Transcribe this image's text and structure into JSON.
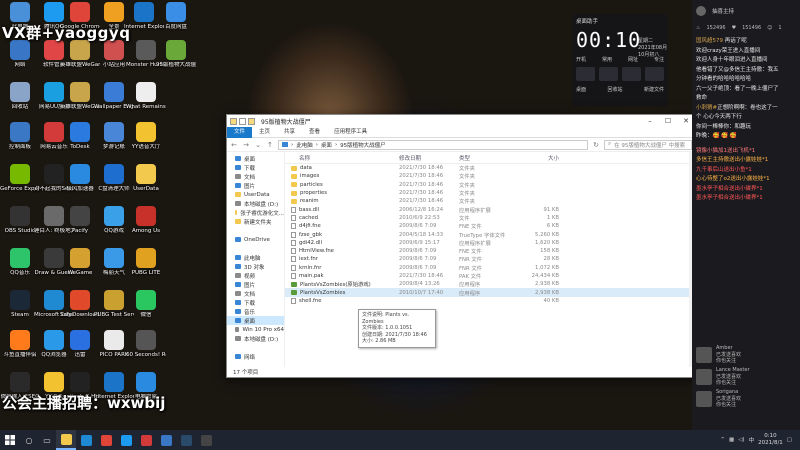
{
  "overlay": {
    "top_text": "VX群+yaoggyq",
    "bottom_text": "公会主播招聘：wxwbij"
  },
  "desktop_icons": [
    {
      "label": "此电脑",
      "color": "#4a90d9",
      "col": 0,
      "row": 0
    },
    {
      "label": "腾讯QQ",
      "color": "#1d9bf0",
      "col": 1,
      "row": 0
    },
    {
      "label": "Google Chrome",
      "color": "#e0453a",
      "col": 2,
      "row": 0
    },
    {
      "label": "全景",
      "color": "#f0a020",
      "col": 3,
      "row": 0
    },
    {
      "label": "Internet Explorer",
      "color": "#1c74c8",
      "col": 3,
      "row": 0.0
    },
    {
      "label": "百度网盘",
      "color": "#3a8ee6",
      "col": 4,
      "row": 0
    },
    {
      "label": "网络",
      "color": "#3a76c6",
      "col": 0,
      "row": 1
    },
    {
      "label": "软件管家",
      "color": "#e04646",
      "col": 1,
      "row": 1
    },
    {
      "label": "英雄联盟WeGame版",
      "color": "#c8a44a",
      "col": 2,
      "row": 1
    },
    {
      "label": "小站应用",
      "color": "#d05050",
      "col": 3,
      "row": 1
    },
    {
      "label": "Monster Hunter ...",
      "color": "#5a5a5a",
      "col": 4,
      "row": 1
    },
    {
      "label": "95版植物大战僵尸",
      "color": "#6aa83a",
      "col": 5,
      "row": 1
    },
    {
      "label": "回收站",
      "color": "#8aa4c8",
      "col": 0,
      "row": 2
    },
    {
      "label": "网易UU加速",
      "color": "#1aa0e0",
      "col": 1,
      "row": 2
    },
    {
      "label": "英雄联盟WeGame版",
      "color": "#c8a44a",
      "col": 2,
      "row": 2
    },
    {
      "label": "Wallpaper Engine:...",
      "color": "#3a7cd6",
      "col": 3,
      "row": 2
    },
    {
      "label": "What Remains ...",
      "color": "#eeeeee",
      "col": 4,
      "row": 2
    },
    {
      "label": "控制面板",
      "color": "#3a78c6",
      "col": 0,
      "row": 3
    },
    {
      "label": "网易云音乐",
      "color": "#d33a3a",
      "col": 1,
      "row": 3
    },
    {
      "label": "ToDesk",
      "color": "#2a7ae0",
      "col": 2,
      "row": 3
    },
    {
      "label": "梦游记账",
      "color": "#4a86d8",
      "col": 3,
      "row": 3
    },
    {
      "label": "YY语音大厅",
      "color": "#f2c230",
      "col": 4,
      "row": 3
    },
    {
      "label": "GeForce Experience",
      "color": "#76b900",
      "col": 0,
      "row": 4
    },
    {
      "label": "对不起我的Soul Dossier",
      "color": "#222222",
      "col": 1,
      "row": 4
    },
    {
      "label": "极风加速器",
      "color": "#2a8ae0",
      "col": 2,
      "row": 4
    },
    {
      "label": "C盘清理大师",
      "color": "#1e6ed0",
      "col": 3,
      "row": 4
    },
    {
      "label": "UserData",
      "color": "#f3c94d",
      "col": 4,
      "row": 4
    },
    {
      "label": "OBS Studio",
      "color": "#333333",
      "col": 0,
      "row": 5
    },
    {
      "label": "锤目人: 终极地大篇",
      "color": "#6a6a6a",
      "col": 1,
      "row": 5
    },
    {
      "label": "Pacify",
      "color": "#444444",
      "col": 2,
      "row": 5
    },
    {
      "label": "QQ游戏",
      "color": "#3aa0e8",
      "col": 3,
      "row": 5
    },
    {
      "label": "Among Us",
      "color": "#c8302a",
      "col": 4,
      "row": 5
    },
    {
      "label": "QQ音乐",
      "color": "#2ec46a",
      "col": 0,
      "row": 6
    },
    {
      "label": "Draw & Guess",
      "color": "#3a3a3a",
      "col": 1,
      "row": 6
    },
    {
      "label": "WeGame",
      "color": "#d4a030",
      "col": 2,
      "row": 6
    },
    {
      "label": "梅丽天气",
      "color": "#3a9ae8",
      "col": 3,
      "row": 6
    },
    {
      "label": "PUBG LITE",
      "color": "#e0a020",
      "col": 4,
      "row": 6
    },
    {
      "label": "Steam",
      "color": "#1b2838",
      "col": 0,
      "row": 7
    },
    {
      "label": "Microsoft Edge",
      "color": "#1f8ad2",
      "col": 1,
      "row": 7
    },
    {
      "label": "SafeDownloader_sogo...",
      "color": "#e04a2a",
      "col": 2,
      "row": 7
    },
    {
      "label": "PUBG Test Server",
      "color": "#caa030",
      "col": 3,
      "row": 7
    },
    {
      "label": "微信",
      "color": "#2ac760",
      "col": 4,
      "row": 7
    },
    {
      "label": "斗鱼直播伴侣",
      "color": "#ff7a1a",
      "col": 0,
      "row": 8
    },
    {
      "label": "QQ浏览器",
      "color": "#2a9ae8",
      "col": 1,
      "row": 8
    },
    {
      "label": "迅雷",
      "color": "#2a70e0",
      "col": 2,
      "row": 8
    },
    {
      "label": "PICO PARK",
      "color": "#eaeaea",
      "col": 3,
      "row": 8
    },
    {
      "label": "60 Seconds! Reatomized",
      "color": "#555555",
      "col": 4,
      "row": 8
    },
    {
      "label": "微信输入法SEO",
      "color": "#2a2a2a",
      "col": 0,
      "row": 9
    },
    {
      "label": "YY语音",
      "color": "#f2c230",
      "col": 1,
      "row": 9
    },
    {
      "label": "Logitech G HUB 9.02",
      "color": "#222222",
      "col": 2,
      "row": 9
    },
    {
      "label": "Internet Explorer",
      "color": "#1c74c8",
      "col": 3,
      "row": 9
    },
    {
      "label": "电脑管家",
      "color": "#2a8ae0",
      "col": 4,
      "row": 9
    }
  ],
  "clock_widget": {
    "title": "桌面助手",
    "time": "00:10",
    "date_line1": "星期二",
    "date_line2": "2021年08月",
    "date_line3": "10月初八",
    "links": [
      "开机",
      "常用",
      "网址",
      "专注",
      "文件"
    ],
    "actions": [
      "桌面",
      "回收站",
      "新建文件"
    ]
  },
  "explorer": {
    "title": "95版植物大战僵尸",
    "ribbon_tabs": [
      "文件",
      "主页",
      "共享",
      "查看",
      "应用程序工具"
    ],
    "active_tab_index": 0,
    "address_parts": [
      "此电脑",
      "桌面",
      "95版植物大战僵尸"
    ],
    "search_placeholder": "在 95版植物大战僵尸 中搜索",
    "nav_items": [
      {
        "label": "桌面",
        "color": "#3a86d6",
        "selected": false
      },
      {
        "label": "下载",
        "color": "#3a86d6",
        "selected": false
      },
      {
        "label": "文档",
        "color": "#8a8a8a",
        "selected": false
      },
      {
        "label": "图片",
        "color": "#3a86d6",
        "selected": false
      },
      {
        "label": "UserData",
        "color": "#f3c94d",
        "selected": false
      },
      {
        "label": "本地磁盘 (D:)",
        "color": "#888888",
        "selected": false
      },
      {
        "label": "张子睿优游化文...",
        "color": "#f3c94d",
        "selected": false
      },
      {
        "label": "新建文件夹",
        "color": "#f3c94d",
        "selected": false
      },
      {
        "label": "",
        "color": "transparent",
        "selected": false
      },
      {
        "label": "OneDrive",
        "color": "#3a86d6",
        "selected": false
      },
      {
        "label": "",
        "color": "transparent",
        "selected": false
      },
      {
        "label": "此电脑",
        "color": "#3a86d6",
        "selected": false
      },
      {
        "label": "3D 对象",
        "color": "#3a86d6",
        "selected": false
      },
      {
        "label": "视频",
        "color": "#8a8a8a",
        "selected": false
      },
      {
        "label": "图片",
        "color": "#3a86d6",
        "selected": false
      },
      {
        "label": "文档",
        "color": "#8a8a8a",
        "selected": false
      },
      {
        "label": "下载",
        "color": "#3a86d6",
        "selected": false
      },
      {
        "label": "音乐",
        "color": "#3a86d6",
        "selected": false
      },
      {
        "label": "桌面",
        "color": "#3a86d6",
        "selected": true
      },
      {
        "label": "Win 10 Pro x64",
        "color": "#888888",
        "selected": false
      },
      {
        "label": "本地磁盘 (D:)",
        "color": "#888888",
        "selected": false
      },
      {
        "label": "",
        "color": "transparent",
        "selected": false
      },
      {
        "label": "网络",
        "color": "#3a86d6",
        "selected": false
      }
    ],
    "columns": [
      "名称",
      "修改日期",
      "类型",
      "大小"
    ],
    "files": [
      {
        "name": "data",
        "date": "2021/7/30 18:46",
        "type": "文件夹",
        "size": "",
        "icon": "folder"
      },
      {
        "name": "images",
        "date": "2021/7/30 18:46",
        "type": "文件夹",
        "size": "",
        "icon": "folder"
      },
      {
        "name": "particles",
        "date": "2021/7/30 18:46",
        "type": "文件夹",
        "size": "",
        "icon": "folder"
      },
      {
        "name": "properties",
        "date": "2021/7/30 18:46",
        "type": "文件夹",
        "size": "",
        "icon": "folder"
      },
      {
        "name": "reanim",
        "date": "2021/7/30 18:46",
        "type": "文件夹",
        "size": "",
        "icon": "folder"
      },
      {
        "name": "bass.dll",
        "date": "2006/12/8 16:24",
        "type": "应用程序扩展",
        "size": "91 KB",
        "icon": "file"
      },
      {
        "name": "cached",
        "date": "2010/6/9 22:53",
        "type": "文件",
        "size": "1 KB",
        "icon": "file"
      },
      {
        "name": "d4jfi.fne",
        "date": "2009/8/6 7:09",
        "type": "FNE 文件",
        "size": "6 KB",
        "icon": "file"
      },
      {
        "name": "fzse_gbk",
        "date": "2004/5/18 14:33",
        "type": "TrueType 字体文件",
        "size": "5,260 KB",
        "icon": "file"
      },
      {
        "name": "gdi42.dll",
        "date": "2009/6/9 15:17",
        "type": "应用程序扩展",
        "size": "1,620 KB",
        "icon": "file"
      },
      {
        "name": "HtmlView.fne",
        "date": "2009/8/6 7:09",
        "type": "FNE 文件",
        "size": "158 KB",
        "icon": "file"
      },
      {
        "name": "iext.fnr",
        "date": "2009/8/6 7:09",
        "type": "FNR 文件",
        "size": "28 KB",
        "icon": "file"
      },
      {
        "name": "krnln.fnr",
        "date": "2009/8/6 7:09",
        "type": "FNR 文件",
        "size": "1,072 KB",
        "icon": "file"
      },
      {
        "name": "main.pak",
        "date": "2021/7/30 18:46",
        "type": "PAK 文件",
        "size": "24,434 KB",
        "icon": "file"
      },
      {
        "name": "PlantsVsZombies(原始游戏)",
        "date": "2009/8/4 13:26",
        "type": "应用程序",
        "size": "2,938 KB",
        "icon": "app"
      },
      {
        "name": "PlantsVsZombies",
        "date": "2010/10/7 17:40",
        "type": "应用程序",
        "size": "2,938 KB",
        "icon": "app"
      },
      {
        "name": "shell.fne",
        "date": "",
        "type": "",
        "size": "40 KB",
        "icon": "file"
      }
    ],
    "highlighted_row_index": 15,
    "tooltip": [
      "文件说明: Plants vs. Zombies",
      "文件版本: 1.0.0.1051",
      "创建日期: 2021/7/30 18:46",
      "大小: 2.86 MB"
    ],
    "status": "17 个项目"
  },
  "chat": {
    "header_name": "抽喜主持",
    "stats": [
      "152496",
      "151496",
      "1"
    ],
    "messages": [
      {
        "user": "国风超579",
        "text": " 再话了呢"
      },
      {
        "user": "",
        "text": "欢迎crazy荣王进入直播间"
      },
      {
        "user": "",
        "text": "欢迎人身十年眼泪进入直播间"
      },
      {
        "user": "",
        "text": "他看错了又@多信王主持傲：我五"
      },
      {
        "user": "",
        "text": "分钟看的哈哈哈哈哈哈"
      },
      {
        "user": "",
        "text": "六一父子绝顶：看了一晚上僵尸了"
      },
      {
        "user": "",
        "text": "救命"
      },
      {
        "user": "小刺猬#",
        "text": "正想阶啊啊：卷也这了一"
      },
      {
        "user": "",
        "text": "个 心心今天两下行"
      },
      {
        "user": "",
        "text": "你间一棒棒你：和趣玩"
      },
      {
        "user": "",
        "text": "昨晚：🥰 🥰 🥰"
      }
    ],
    "gifts": [
      {
        "text": "镜像小猫加1送出飞机*1",
        "tone": "pink"
      },
      {
        "text": "多信王主持傲送出小露娃娃*1",
        "tone": "orange"
      },
      {
        "text": "九千事后山送出小鱼*1",
        "tone": "red"
      },
      {
        "text": "心心待整了o2送出小露娃娃*1",
        "tone": "orange"
      },
      {
        "text": "墨水亭子相合送出小碟界*1",
        "tone": "red"
      },
      {
        "text": "墨水亭子相合送出小碟界*1",
        "tone": "red"
      }
    ],
    "viewers": [
      {
        "name": "Amber",
        "line1": "已发送喜欢",
        "line2": "你也关注"
      },
      {
        "name": "Lance Master",
        "line1": "已发送喜欢",
        "line2": "你也关注"
      },
      {
        "name": "Sorigana",
        "line1": "已发送喜欢",
        "line2": "你也关注"
      }
    ]
  },
  "taskbar": {
    "apps": [
      {
        "name": "file-explorer",
        "color": "#f3c94d",
        "active": true
      },
      {
        "name": "edge",
        "color": "#1f8ad2",
        "active": false
      },
      {
        "name": "chrome",
        "color": "#e0453a",
        "active": false
      },
      {
        "name": "qq",
        "color": "#1d9bf0",
        "active": false
      },
      {
        "name": "netease",
        "color": "#d33a3a",
        "active": false
      },
      {
        "name": "windows-store",
        "color": "#3a78c6",
        "active": false
      },
      {
        "name": "steam",
        "color": "#2a4a6a",
        "active": false
      },
      {
        "name": "obs",
        "color": "#444444",
        "active": false
      }
    ],
    "time": "0:10",
    "date": "2021/8/1",
    "lang": "中"
  }
}
